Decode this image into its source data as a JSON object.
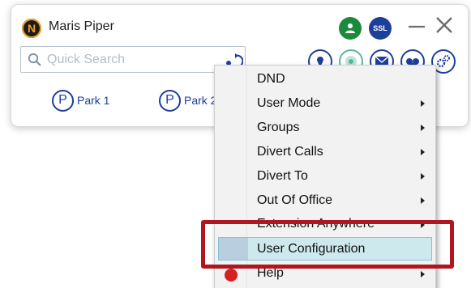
{
  "window": {
    "logo_letter": "N",
    "title": "Maris Piper",
    "ssl_badge": "SSL",
    "status_color": "#1b8a3c",
    "accent_color": "#1d3f9c"
  },
  "search": {
    "placeholder": "Quick Search"
  },
  "toolbar": {
    "icons": [
      "person-pin-icon",
      "presence-icon",
      "mail-icon",
      "voicemail-icon",
      "settings-icon"
    ]
  },
  "park": [
    {
      "letter": "P",
      "label": "Park 1"
    },
    {
      "letter": "P",
      "label": "Park 2"
    }
  ],
  "menu": {
    "items": [
      {
        "label": "DND",
        "has_submenu": false
      },
      {
        "label": "User Mode",
        "has_submenu": true
      },
      {
        "label": "Groups",
        "has_submenu": true
      },
      {
        "label": "Divert Calls",
        "has_submenu": true
      },
      {
        "label": "Divert To",
        "has_submenu": true
      },
      {
        "label": "Out Of Office",
        "has_submenu": true
      },
      {
        "label": "Extension Anywhere",
        "has_submenu": true
      },
      {
        "label": "User Configuration",
        "has_submenu": false,
        "selected": true
      },
      {
        "label": "Help",
        "has_submenu": true
      }
    ]
  },
  "annotation": {
    "color": "#b0161e"
  }
}
